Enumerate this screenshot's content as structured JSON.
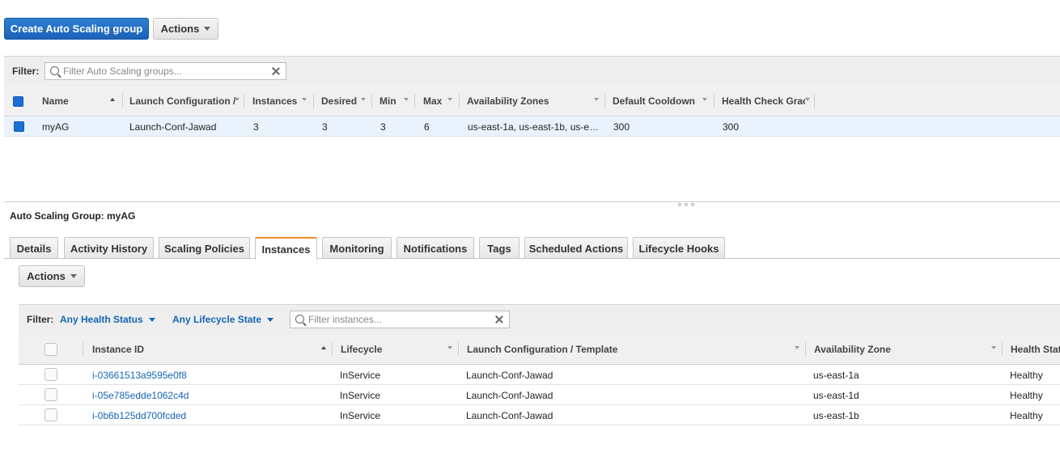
{
  "toolbar": {
    "create_label": "Create Auto Scaling group",
    "actions_label": "Actions"
  },
  "asg_filter": {
    "label": "Filter:",
    "placeholder": "Filter Auto Scaling groups..."
  },
  "asg_table": {
    "columns": [
      "Name",
      "Launch Configuration /",
      "Instances",
      "Desired",
      "Min",
      "Max",
      "Availability Zones",
      "Default Cooldown",
      "Health Check Grac"
    ],
    "row": {
      "name": "myAG",
      "launch_config": "Launch-Conf-Jawad",
      "instances": "3",
      "desired": "3",
      "min": "3",
      "max": "6",
      "zones": "us-east-1a, us-east-1b, us-e…",
      "cooldown": "300",
      "grace": "300"
    }
  },
  "detail": {
    "title": "Auto Scaling Group: myAG",
    "tabs": [
      "Details",
      "Activity History",
      "Scaling Policies",
      "Instances",
      "Monitoring",
      "Notifications",
      "Tags",
      "Scheduled Actions",
      "Lifecycle Hooks"
    ],
    "active_tab": "Instances",
    "actions_label": "Actions"
  },
  "inst_filter": {
    "label": "Filter:",
    "health": "Any Health Status",
    "lifecycle": "Any Lifecycle State",
    "placeholder": "Filter instances..."
  },
  "inst_table": {
    "columns": [
      "Instance ID",
      "Lifecycle",
      "Launch Configuration / Template",
      "Availability Zone",
      "Health Statu"
    ],
    "rows": [
      {
        "id": "i-03661513a9595e0f8",
        "lifecycle": "InService",
        "config": "Launch-Conf-Jawad",
        "zone": "us-east-1a",
        "health": "Healthy"
      },
      {
        "id": "i-05e785edde1062c4d",
        "lifecycle": "InService",
        "config": "Launch-Conf-Jawad",
        "zone": "us-east-1d",
        "health": "Healthy"
      },
      {
        "id": "i-0b6b125dd700fcded",
        "lifecycle": "InService",
        "config": "Launch-Conf-Jawad",
        "zone": "us-east-1b",
        "health": "Healthy"
      }
    ]
  },
  "colors": {
    "primary": "#1a62b8",
    "link": "#1565b5",
    "active_tab_accent": "#f08a24",
    "selected_row": "#eaf3fd"
  }
}
